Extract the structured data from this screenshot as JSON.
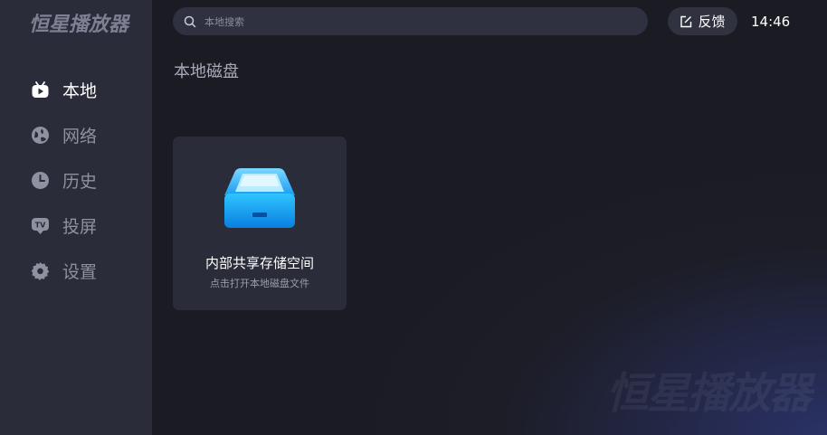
{
  "app": {
    "logo_text": "恒星播放器",
    "watermark_text": "恒星播放器"
  },
  "sidebar": {
    "items": [
      {
        "label": "本地",
        "icon": "play-tv-icon",
        "active": true
      },
      {
        "label": "网络",
        "icon": "globe-icon",
        "active": false
      },
      {
        "label": "历史",
        "icon": "clock-icon",
        "active": false
      },
      {
        "label": "投屏",
        "icon": "tv-cast-icon",
        "active": false
      },
      {
        "label": "设置",
        "icon": "gear-icon",
        "active": false
      }
    ]
  },
  "header": {
    "search_placeholder": "本地搜索",
    "feedback_label": "反馈",
    "time": "14:46"
  },
  "main": {
    "section_title": "本地磁盘",
    "cards": [
      {
        "title": "内部共享存储空间",
        "subtitle": "点击打开本地磁盘文件",
        "icon": "storage-drive-icon"
      }
    ]
  },
  "colors": {
    "accent": "#1fa6f0",
    "sidebar_bg": "#2a2c39",
    "card_bg": "#2a2d39"
  }
}
